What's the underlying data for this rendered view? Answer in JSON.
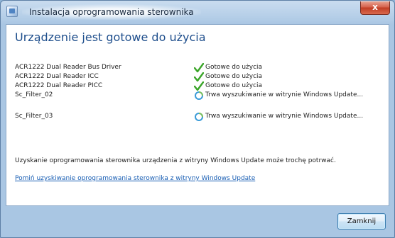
{
  "window": {
    "title": "Instalacja oprogramowania sterownika",
    "close_label": "x"
  },
  "heading": "Urządzenie jest gotowe do użycia",
  "devices": [
    {
      "name": "ACR1222 Dual Reader Bus Driver",
      "status": "Gotowe do użycia",
      "status_icon": "checkmark-icon"
    },
    {
      "name": "ACR1222 Dual Reader ICC",
      "status": "Gotowe do użycia",
      "status_icon": "checkmark-icon"
    },
    {
      "name": "ACR1222 Dual Reader PICC",
      "status": "Gotowe do użycia",
      "status_icon": "checkmark-icon"
    },
    {
      "name": "Sc_Filter_02",
      "status": "Trwa wyszukiwanie w witrynie Windows Update...",
      "status_icon": "searching-icon"
    },
    {
      "name": "Sc_Filter_03",
      "status": "Trwa wyszukiwanie w witrynie Windows Update...",
      "status_icon": "searching-icon"
    }
  ],
  "notice": "Uzyskanie oprogramowania sterownika urządzenia z witryny Windows Update może trochę potrwać.",
  "help_link": "Pomiń uzyskiwanie oprogramowania sterownika z witryny Windows Update",
  "buttons": {
    "close": "Zamknij"
  },
  "colors": {
    "heading": "#1e4e8c",
    "link": "#1a5fb4",
    "check": "#3aa528",
    "searching": "#3a9bd8"
  }
}
